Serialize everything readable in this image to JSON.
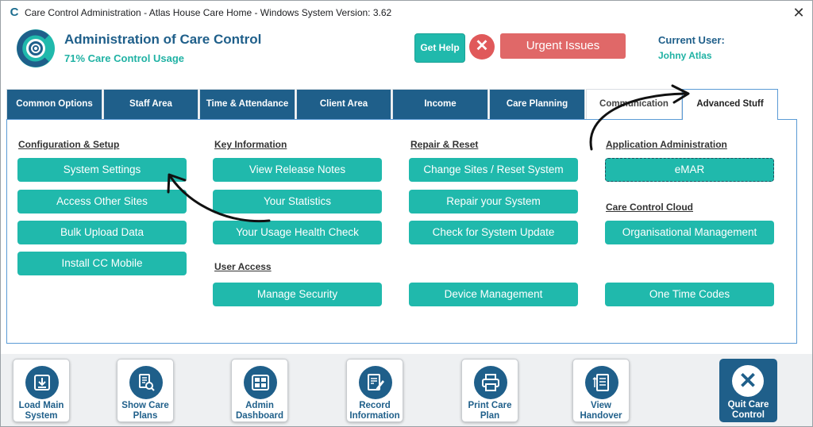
{
  "window": {
    "title": "Care Control Administration - Atlas House Care Home - Windows System Version: 3.62",
    "app_icon": "C",
    "close_symbol": "✕"
  },
  "header": {
    "title": "Administration of Care Control",
    "subtitle": "71% Care Control Usage",
    "get_help": "Get Help",
    "urgent": "Urgent Issues",
    "current_user_label": "Current User:",
    "current_user": "Johny Atlas"
  },
  "tabs": [
    {
      "label": "Common Options"
    },
    {
      "label": "Staff Area"
    },
    {
      "label": "Time & Attendance"
    },
    {
      "label": "Client Area"
    },
    {
      "label": "Income"
    },
    {
      "label": "Care Planning"
    },
    {
      "label": "Communication"
    },
    {
      "label": "Advanced Stuff"
    }
  ],
  "sections": {
    "config": {
      "title": "Configuration & Setup",
      "buttons": [
        "System Settings",
        "Access Other Sites",
        "Bulk Upload Data",
        "Install CC Mobile"
      ]
    },
    "key": {
      "title": "Key Information",
      "buttons": [
        "View Release Notes",
        "Your Statistics",
        "Your Usage Health Check"
      ]
    },
    "user_access": {
      "title": "User Access",
      "buttons": [
        "Manage Security"
      ]
    },
    "repair": {
      "title": "Repair & Reset",
      "buttons": [
        "Change Sites / Reset System",
        "Repair your System",
        "Check for System Update",
        "Device Management"
      ]
    },
    "app_admin": {
      "title": "Application Administration",
      "buttons": [
        "eMAR"
      ]
    },
    "cloud": {
      "title": "Care Control Cloud",
      "buttons": [
        "Organisational Management",
        "One Time Codes"
      ]
    }
  },
  "toolbar": [
    {
      "line1": "Load Main",
      "line2": "System",
      "icon": "download-icon"
    },
    {
      "line1": "Show Care",
      "line2": "Plans",
      "icon": "document-search-icon"
    },
    {
      "line1": "Admin",
      "line2": "Dashboard",
      "icon": "dashboard-icon"
    },
    {
      "line1": "Record",
      "line2": "Information",
      "icon": "edit-document-icon"
    },
    {
      "line1": "Print Care",
      "line2": "Plan",
      "icon": "printer-icon"
    },
    {
      "line1": "View",
      "line2": "Handover",
      "icon": "list-icon"
    }
  ],
  "quit": {
    "line1": "Quit Care",
    "line2": "Control",
    "symbol": "✕"
  },
  "colors": {
    "brand_blue": "#1f5f8a",
    "teal": "#20b9ac",
    "urgent_red": "#e06868"
  }
}
